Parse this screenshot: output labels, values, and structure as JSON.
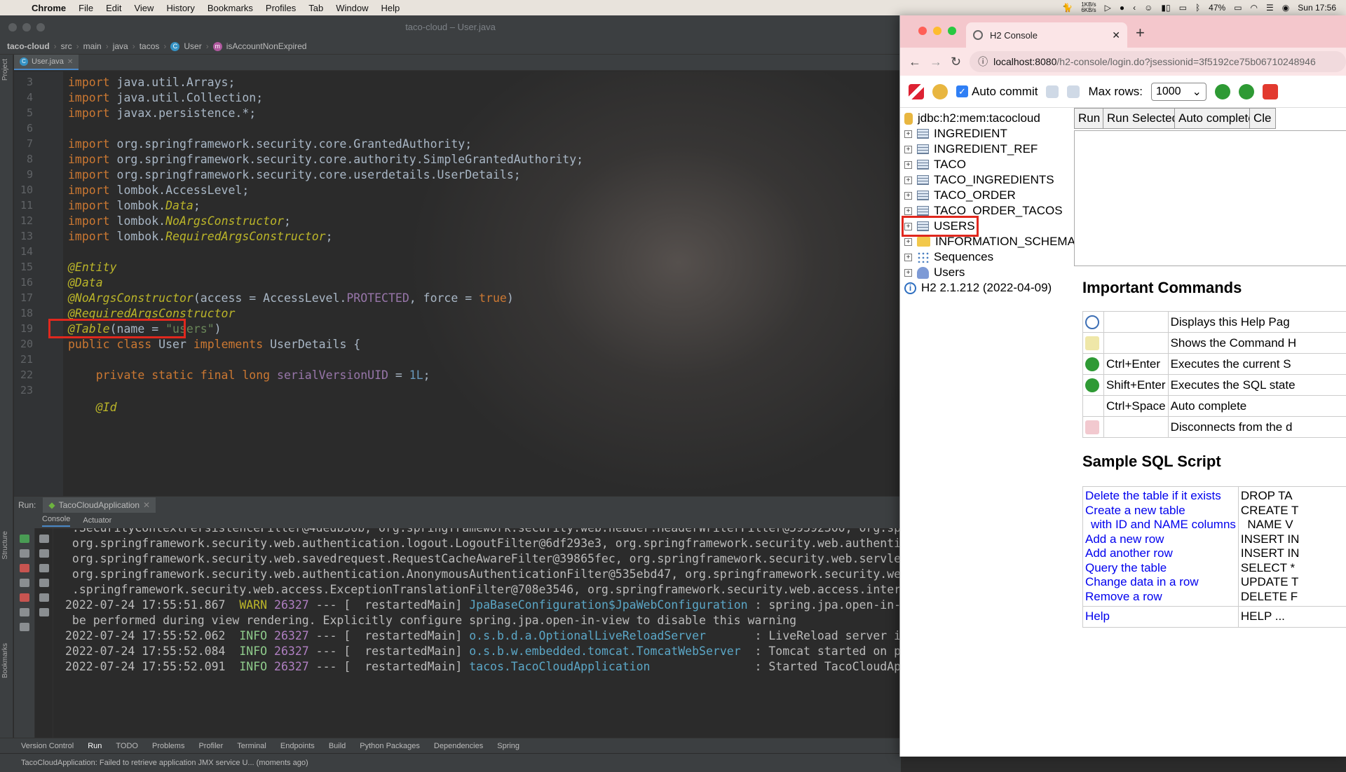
{
  "menubar": {
    "app": "Chrome",
    "items": [
      "File",
      "Edit",
      "View",
      "History",
      "Bookmarks",
      "Profiles",
      "Tab",
      "Window",
      "Help"
    ],
    "net_up": "1KB/s",
    "net_down": "6KB/s",
    "battery": "47%",
    "clock": "Sun 17:56"
  },
  "ide": {
    "window_title": "taco-cloud – User.java",
    "breadcrumb": [
      "taco-cloud",
      "src",
      "main",
      "java",
      "tacos",
      "User",
      "isAccountNonExpired"
    ],
    "sidebar_project": "Project",
    "sidebar_structure": "Structure",
    "sidebar_bookmarks": "Bookmarks",
    "editor_tab": "User.java",
    "line_numbers": [
      "3",
      "4",
      "5",
      "6",
      "7",
      "8",
      "9",
      "10",
      "11",
      "12",
      "13",
      "14",
      "15",
      "16",
      "17",
      "18",
      "19",
      "20",
      "21",
      "22",
      "23"
    ],
    "code": {
      "l3a": "import",
      "l3b": " java.util.Arrays;",
      "l4a": "import",
      "l4b": " java.util.Collection;",
      "l5a": "import",
      "l5b": " javax.persistence.*;",
      "l7a": "import",
      "l7b": " org.springframework.security.core.GrantedAuthority;",
      "l8a": "import",
      "l8b": " org.springframework.security.core.authority.SimpleGrantedAuthority;",
      "l9a": "import",
      "l9b": " org.springframework.security.core.userdetails.UserDetails;",
      "l10a": "import",
      "l10b": " lombok.AccessLevel;",
      "l11a": "import",
      "l11b": " lombok.",
      "l11c": "Data",
      "l11d": ";",
      "l12a": "import",
      "l12b": " lombok.",
      "l12c": "NoArgsConstructor",
      "l12d": ";",
      "l13a": "import",
      "l13b": " lombok.",
      "l13c": "RequiredArgsConstructor",
      "l13d": ";",
      "l15": "@Entity",
      "l16": "@Data",
      "l17a": "@NoArgsConstructor",
      "l17b": "(access = AccessLevel.",
      "l17c": "PROTECTED",
      "l17d": ", force = ",
      "l17e": "true",
      "l17f": ")",
      "l18": "@RequiredArgsConstructor",
      "l19a": "@Table",
      "l19b": "(name = ",
      "l19c": "\"users\"",
      "l19d": ")",
      "l20a": "public class",
      "l20b": " User ",
      "l20c": "implements",
      "l20d": " UserDetails {",
      "l22a": "    private static final long",
      "l22b": " serialVersionUID",
      "l22c": " = ",
      "l22d": "1L",
      "l22e": ";",
      "l24": "    @Id"
    },
    "run_label": "Run:",
    "run_tab": "TacoCloudApplication",
    "console_tab": "Console",
    "actuator_tab": "Actuator",
    "console": {
      "c1": " .SecurityContextPersistenceFilter@4dedb36b, org.springframework.security.web.header.HeaderWriterFilter@59392300, org.sp",
      "c2": " org.springframework.security.web.authentication.logout.LogoutFilter@6df293e3, org.springframework.security.web.authenti",
      "c3": " org.springframework.security.web.savedrequest.RequestCacheAwareFilter@39865fec, org.springframework.security.web.servle",
      "c4": " org.springframework.security.web.authentication.AnonymousAuthenticationFilter@535ebd47, org.springframework.security.we",
      "c5": " .springframework.security.web.access.ExceptionTranslationFilter@708e3546, org.springframework.security.web.access.inter",
      "c6_ts": "2022-07-24 17:55:51.867  ",
      "c6_lvl": "WARN",
      "c6_pid": " 26327",
      "c6_mid": " --- [  restartedMain] ",
      "c6_log": "JpaBaseConfiguration$JpaWebConfiguration",
      "c6_msg": " : spring.jpa.open-in-",
      "c7": " be performed during view rendering. Explicitly configure spring.jpa.open-in-view to disable this warning",
      "c8_ts": "2022-07-24 17:55:52.062  ",
      "c8_lvl": "INFO",
      "c8_pid": " 26327",
      "c8_mid": " --- [  restartedMain] ",
      "c8_log": "o.s.b.d.a.OptionalLiveReloadServer      ",
      "c8_msg": " : LiveReload server i",
      "c9_ts": "2022-07-24 17:55:52.084  ",
      "c9_lvl": "INFO",
      "c9_pid": " 26327",
      "c9_mid": " --- [  restartedMain] ",
      "c9_log": "o.s.b.w.embedded.tomcat.TomcatWebServer ",
      "c9_msg": " : Tomcat started on p",
      "c10_ts": "2022-07-24 17:55:52.091  ",
      "c10_lvl": "INFO",
      "c10_pid": " 26327",
      "c10_mid": " --- [  restartedMain] ",
      "c10_log": "tacos.TacoCloudApplication              ",
      "c10_msg": " : Started TacoCloudAp"
    },
    "bottom_tabs": [
      "Version Control",
      "Run",
      "TODO",
      "Problems",
      "Profiler",
      "Terminal",
      "Endpoints",
      "Build",
      "Python Packages",
      "Dependencies",
      "Spring"
    ],
    "status": "TacoCloudApplication: Failed to retrieve application JMX service U... (moments ago)"
  },
  "chrome": {
    "tab_title": "H2 Console",
    "tab_close": "✕",
    "new_tab": "+",
    "url_host": "localhost:8080",
    "url_path": "/h2-console/login.do?jsessionid=3f5192ce75b06710248946"
  },
  "h2": {
    "auto_commit": "Auto commit",
    "max_rows_label": "Max rows:",
    "max_rows_value": "1000",
    "db_url": "jdbc:h2:mem:tacocloud",
    "tables": [
      "INGREDIENT",
      "INGREDIENT_REF",
      "TACO",
      "TACO_INGREDIENTS",
      "TACO_ORDER",
      "TACO_ORDER_TACOS",
      "USERS"
    ],
    "schema": "INFORMATION_SCHEMA",
    "sequences": "Sequences",
    "users": "Users",
    "version": "H2 2.1.212 (2022-04-09)",
    "buttons": [
      "Run",
      "Run Selected",
      "Auto complete",
      "Cle"
    ],
    "important_commands": "Important Commands",
    "commands": [
      {
        "keys": "",
        "desc": "Displays this Help Pag"
      },
      {
        "keys": "",
        "desc": "Shows the Command H"
      },
      {
        "keys": "Ctrl+Enter",
        "desc": "Executes the current S"
      },
      {
        "keys": "Shift+Enter",
        "desc": "Executes the SQL state"
      },
      {
        "keys": "Ctrl+Space",
        "desc": "Auto complete"
      },
      {
        "keys": "",
        "desc": "Disconnects from the d"
      }
    ],
    "sample_sql": "Sample SQL Script",
    "sql_links": [
      "Delete the table if it exists",
      "Create a new table",
      " with ID and NAME columns",
      "Add a new row",
      "Add another row",
      "Query the table",
      "Change data in a row",
      "Remove a row"
    ],
    "sql_code": [
      "DROP TA",
      "CREATE T",
      "  NAME V",
      "INSERT IN",
      "INSERT IN",
      "SELECT *",
      "UPDATE T",
      "DELETE F"
    ],
    "help_link": "Help",
    "help_code": "HELP ..."
  },
  "colors": {
    "ide_bg": "#2b2b2b",
    "highlight_box": "#e0281e",
    "chrome_tab_bar": "#f4c7cc",
    "link": "#0000ee"
  }
}
